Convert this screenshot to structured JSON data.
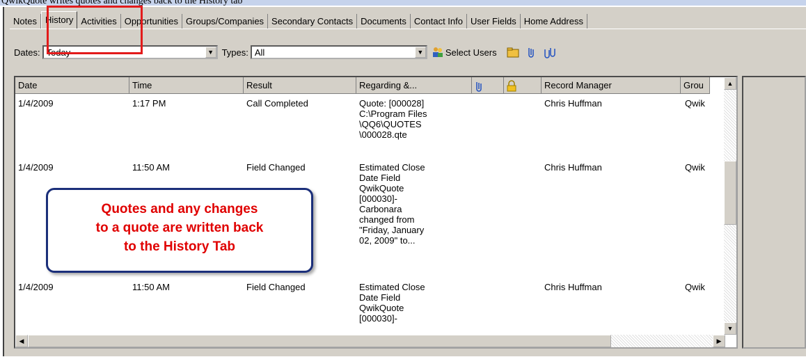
{
  "top_text": "QwikQuote writes quotes and changes back to the History tab",
  "tabs": [
    "Notes",
    "History",
    "Activities",
    "Opportunities",
    "Groups/Companies",
    "Secondary Contacts",
    "Documents",
    "Contact Info",
    "User Fields",
    "Home Address"
  ],
  "active_tab": "History",
  "filters": {
    "dates_label": "Dates:",
    "dates_value": "Today",
    "types_label": "Types:",
    "types_value": "All",
    "select_users_label": "Select Users"
  },
  "columns": [
    "Date",
    "Time",
    "Result",
    "Regarding &...",
    "",
    "",
    "Record Manager",
    "Grou"
  ],
  "rows": [
    {
      "date": "1/4/2009",
      "time": "1:17 PM",
      "result": "Call Completed",
      "regarding": "Quote: [000028]\nC:\\Program Files\n\\QQ6\\QUOTES\n\\000028.qte",
      "manager": "Chris Huffman",
      "group": "Qwik"
    },
    {
      "date": "1/4/2009",
      "time": "11:50 AM",
      "result": "Field Changed",
      "regarding": "Estimated Close\nDate Field\nQwikQuote\n[000030]-\nCarbonara\nchanged from\n\"Friday, January\n02, 2009\" to...",
      "manager": "Chris Huffman",
      "group": "Qwik"
    },
    {
      "date": "1/4/2009",
      "time": "11:50 AM",
      "result": "Field Changed",
      "regarding": "Estimated Close\nDate Field\nQwikQuote\n[000030]-",
      "manager": "Chris Huffman",
      "group": "Qwik"
    }
  ],
  "callout": {
    "line1": "Quotes and any changes",
    "line2": "to a quote are written back",
    "line3": "to the History Tab"
  },
  "colors": {
    "callout_text": "#e00000",
    "callout_border": "#1b2f7a",
    "highlight": "#e31b1b"
  }
}
